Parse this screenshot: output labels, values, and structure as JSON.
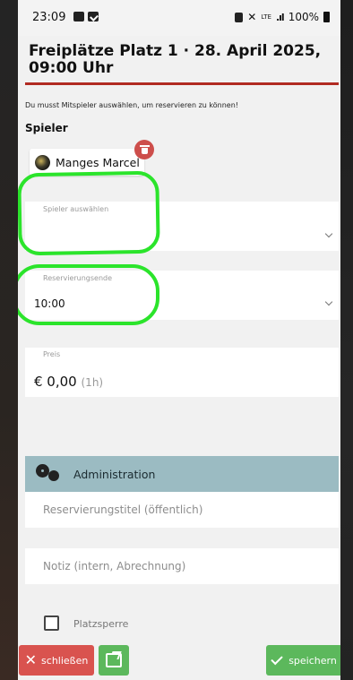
{
  "statusbar": {
    "time": "23:09",
    "network": "LTE",
    "battery": "100%"
  },
  "header": {
    "title": "Freiplätze Platz 1 · 28. April 2025, 09:00 Uhr"
  },
  "form": {
    "warning": "Du musst Mitspieler auswählen, um reservieren zu können!",
    "players_label": "Spieler",
    "selected_player": "Manges Marcel",
    "select_player_label": "Spieler auswählen",
    "select_player_value": "",
    "end_label": "Reservierungsende",
    "end_value": "10:00",
    "price_label": "Preis",
    "price_value": "€ 0,00",
    "price_duration": "(1h)"
  },
  "admin": {
    "section_title": "Administration",
    "title_placeholder": "Reservierungstitel (öffentlich)",
    "note_placeholder": "Notiz (intern, Abrechnung)",
    "lock_label": "Platzsperre",
    "lock_checked": false
  },
  "footer": {
    "close_label": "schließen",
    "save_label": "speichern"
  },
  "colors": {
    "accent_red": "#b12b22",
    "danger": "#d9534f",
    "success": "#5cb85c",
    "admin_header": "#9bbbc2",
    "highlight": "#2be42b"
  },
  "icons": {
    "trash": "trash-icon",
    "gears": "gears-icon",
    "share": "share-icon",
    "close": "close-icon",
    "check": "check-icon",
    "chevron": "chevron-down-icon"
  }
}
